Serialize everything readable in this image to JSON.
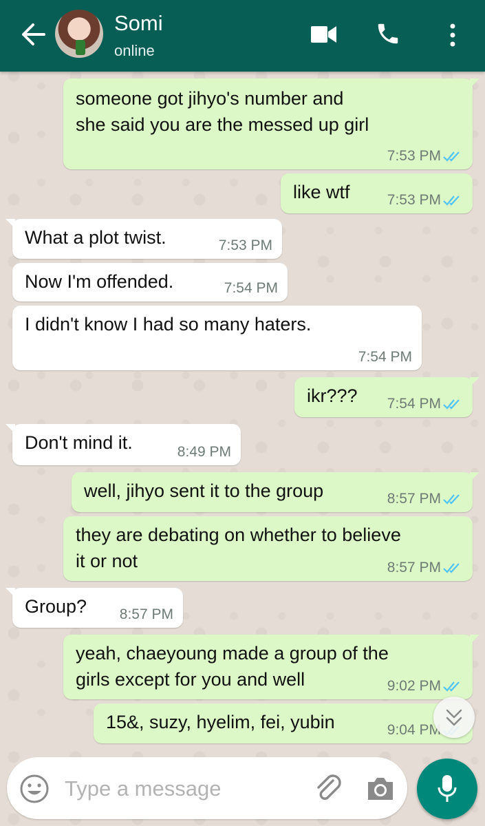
{
  "header": {
    "contact_name": "Somi",
    "status": "online"
  },
  "messages": [
    {
      "direction": "out",
      "lines": [
        "someone got jihyo's number and",
        "she said you are the messed up girl"
      ],
      "time": "7:53 PM",
      "read": true
    },
    {
      "direction": "out",
      "lines": [
        "like wtf"
      ],
      "time": "7:53 PM",
      "read": true
    },
    {
      "direction": "in",
      "lines": [
        "What a plot twist."
      ],
      "time": "7:53 PM"
    },
    {
      "direction": "in",
      "lines": [
        "Now I'm offended."
      ],
      "time": "7:54 PM"
    },
    {
      "direction": "in",
      "lines": [
        "I didn't know I had so many haters."
      ],
      "time": "7:54 PM"
    },
    {
      "direction": "out",
      "lines": [
        "ikr???"
      ],
      "time": "7:54 PM",
      "read": true
    },
    {
      "direction": "in",
      "lines": [
        "Don't mind it."
      ],
      "time": "8:49 PM"
    },
    {
      "direction": "out",
      "lines": [
        "well, jihyo sent it to the group"
      ],
      "time": "8:57 PM",
      "read": true
    },
    {
      "direction": "out",
      "lines": [
        "they are debating on whether to believe",
        "it or not"
      ],
      "time": "8:57 PM",
      "read": true
    },
    {
      "direction": "in",
      "lines": [
        "Group?"
      ],
      "time": "8:57 PM"
    },
    {
      "direction": "out",
      "lines": [
        "yeah, chaeyoung made a group of the",
        "girls except for you and well"
      ],
      "time": "9:02 PM",
      "read": true
    },
    {
      "direction": "out",
      "lines": [
        "15&, suzy, hyelim, fei, yubin"
      ],
      "time": "9:04 PM",
      "read": true
    }
  ],
  "composer": {
    "placeholder": "Type a message"
  },
  "icons": {
    "back": "arrow-left-icon",
    "video": "video-camera-icon",
    "call": "phone-icon",
    "menu": "more-vertical-icon",
    "emoji": "smiley-icon",
    "attach": "paperclip-icon",
    "camera": "camera-icon",
    "mic": "microphone-icon",
    "scroll": "chevron-double-down-icon"
  },
  "colors": {
    "header": "#075e54",
    "outgoing_bubble": "#dcf8c6",
    "incoming_bubble": "#ffffff",
    "read_ticks": "#4fc3f7",
    "mic_button": "#00897b"
  }
}
